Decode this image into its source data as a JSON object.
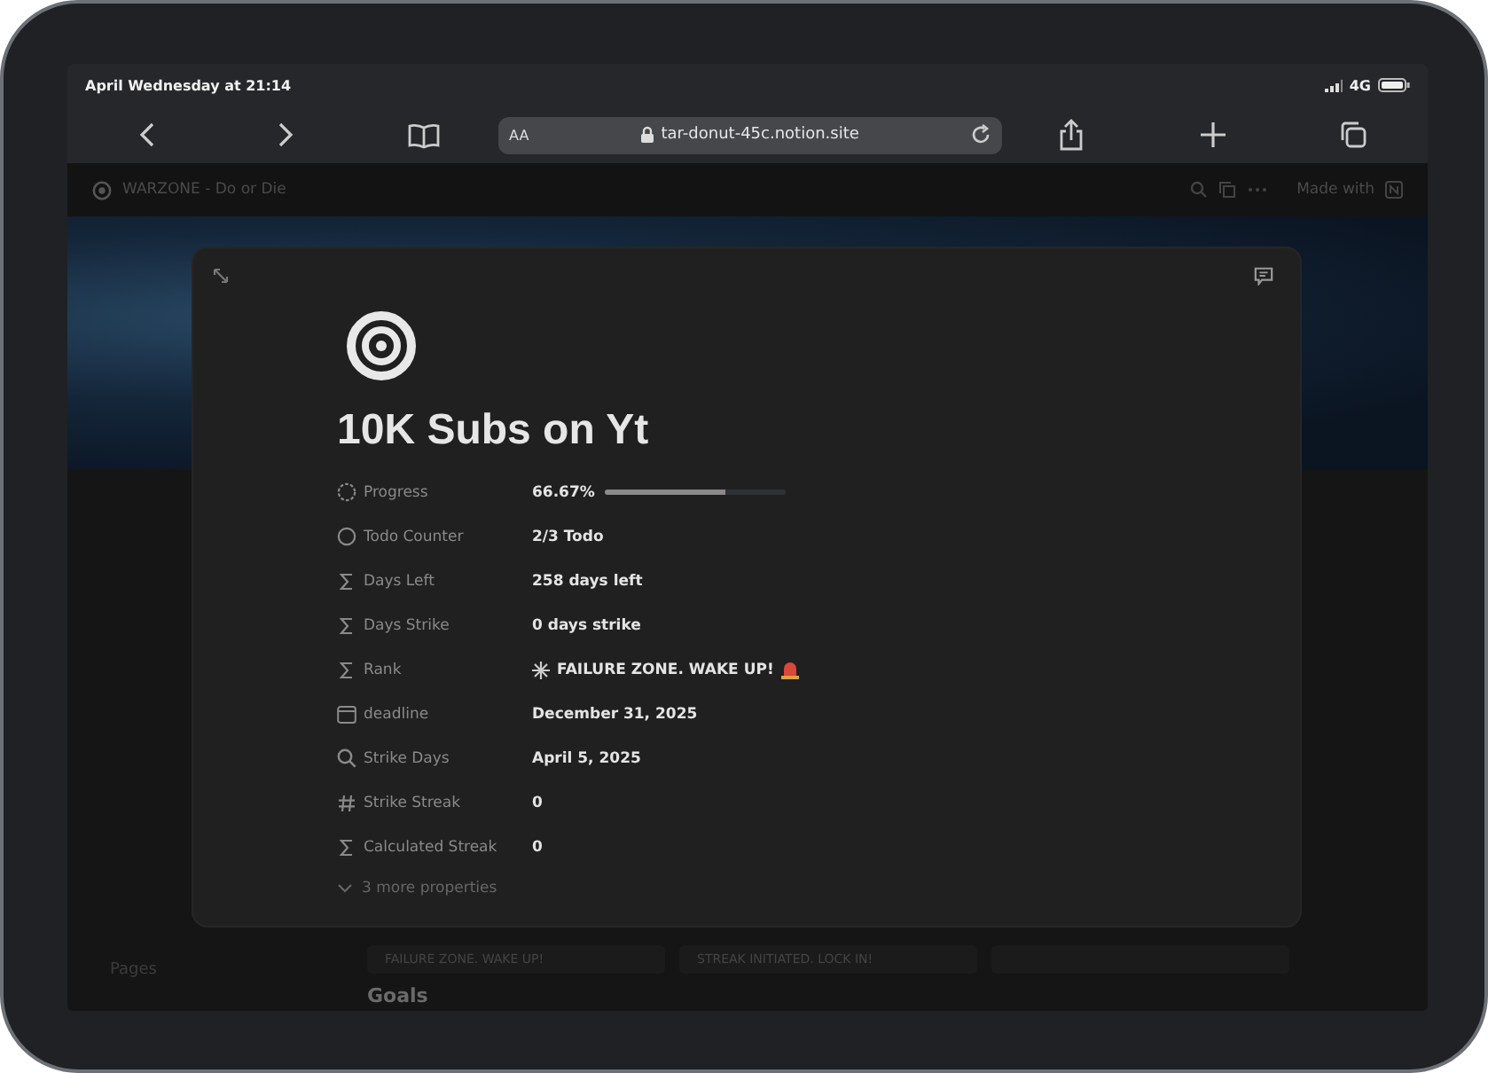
{
  "status_bar": {
    "time": "April Wednesday at 21:14",
    "network": "4G"
  },
  "browser": {
    "text_size_button": "AA",
    "url": "tar-donut-45c.notion.site"
  },
  "notion_header": {
    "breadcrumb": "WARZONE - Do or Die",
    "made_with": "Made with"
  },
  "background_page": {
    "rank_chips": [
      "FAILURE ZONE. WAKE UP!",
      "STREAK INITIATED. LOCK IN!"
    ],
    "sidebar_heading": "Pages",
    "section_heading": "Goals"
  },
  "modal": {
    "title": "10K Subs on Yt",
    "properties": [
      {
        "kind": "rollup",
        "label": "Progress",
        "value": "66.67%",
        "level": 0.6667
      },
      {
        "kind": "status",
        "label": "Todo Counter",
        "value": "2/3 Todo"
      },
      {
        "kind": "formula",
        "label": "Days Left",
        "value": "258 days left"
      },
      {
        "kind": "formula",
        "label": "Days Strike",
        "value": "0 days strike"
      },
      {
        "kind": "formula",
        "label": "Rank",
        "value": "FAILURE ZONE. WAKE UP!"
      },
      {
        "kind": "date",
        "label": "deadline",
        "value": "December 31, 2025"
      },
      {
        "kind": "search",
        "label": "Strike Days",
        "value": "April 5, 2025"
      },
      {
        "kind": "number",
        "label": "Strike Streak",
        "value": "0"
      },
      {
        "kind": "formula",
        "label": "Calculated Streak",
        "value": "0"
      }
    ],
    "more_properties": "3 more properties"
  }
}
